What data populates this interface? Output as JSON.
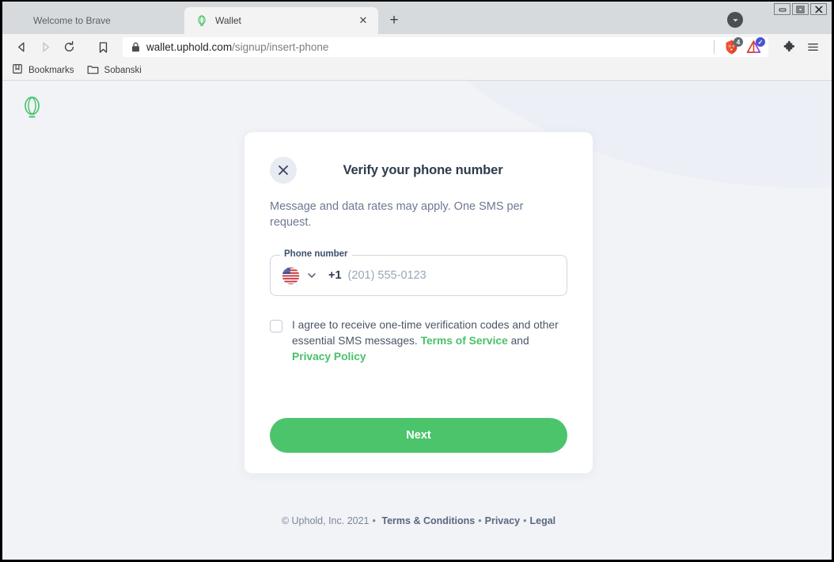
{
  "window": {
    "controls": {
      "minimize": "–",
      "maximize": "❐",
      "close": "✕"
    }
  },
  "tabs": [
    {
      "title": "Welcome to Brave",
      "favicon": "globe-icon",
      "active": false
    },
    {
      "title": "Wallet",
      "favicon": "uphold-balloon-icon",
      "active": true
    }
  ],
  "tabstrip": {
    "new_tab_label": "+",
    "close_tab_label": "✕"
  },
  "toolbar": {
    "back_icon": "back-arrow-icon",
    "forward_icon": "forward-arrow-icon",
    "reload_icon": "reload-icon",
    "bookmark_icon": "bookmark-icon",
    "lock_icon": "lock-icon",
    "url_domain": "wallet.uphold.com",
    "url_path": "/signup/insert-phone",
    "shields_badge": "4",
    "rewards_badge": "✓",
    "extensions_icon": "puzzle-piece-icon",
    "menu_icon": "hamburger-menu-icon"
  },
  "bookmarks_bar": [
    {
      "label": "Bookmarks",
      "icon": "book-icon"
    },
    {
      "label": "Sobanski",
      "icon": "folder-icon"
    }
  ],
  "page": {
    "logo": "uphold-balloon-logo",
    "card": {
      "close_label": "✕",
      "title": "Verify your phone number",
      "subtitle": "Message and data rates may apply. One SMS per request.",
      "phone_field": {
        "legend": "Phone number",
        "flag": "us-flag-icon",
        "dial_code": "+1",
        "value": "",
        "placeholder": "(201) 555-0123"
      },
      "agreement": {
        "checked": false,
        "text_part1": "I agree to receive one-time verification codes and other essential SMS messages. ",
        "link_terms": "Terms of Service",
        "text_and": " and ",
        "link_privacy": "Privacy Policy"
      },
      "next_label": "Next"
    },
    "footer": {
      "copyright": "© Uphold, Inc. 2021",
      "bullet": "•",
      "link_terms": "Terms & Conditions",
      "link_privacy": "Privacy",
      "link_legal": "Legal"
    }
  },
  "colors": {
    "brand_green": "#4cc46c",
    "text_dark": "#2e3a4d",
    "muted": "#6d7891",
    "page_bg": "#f1f3f7"
  }
}
